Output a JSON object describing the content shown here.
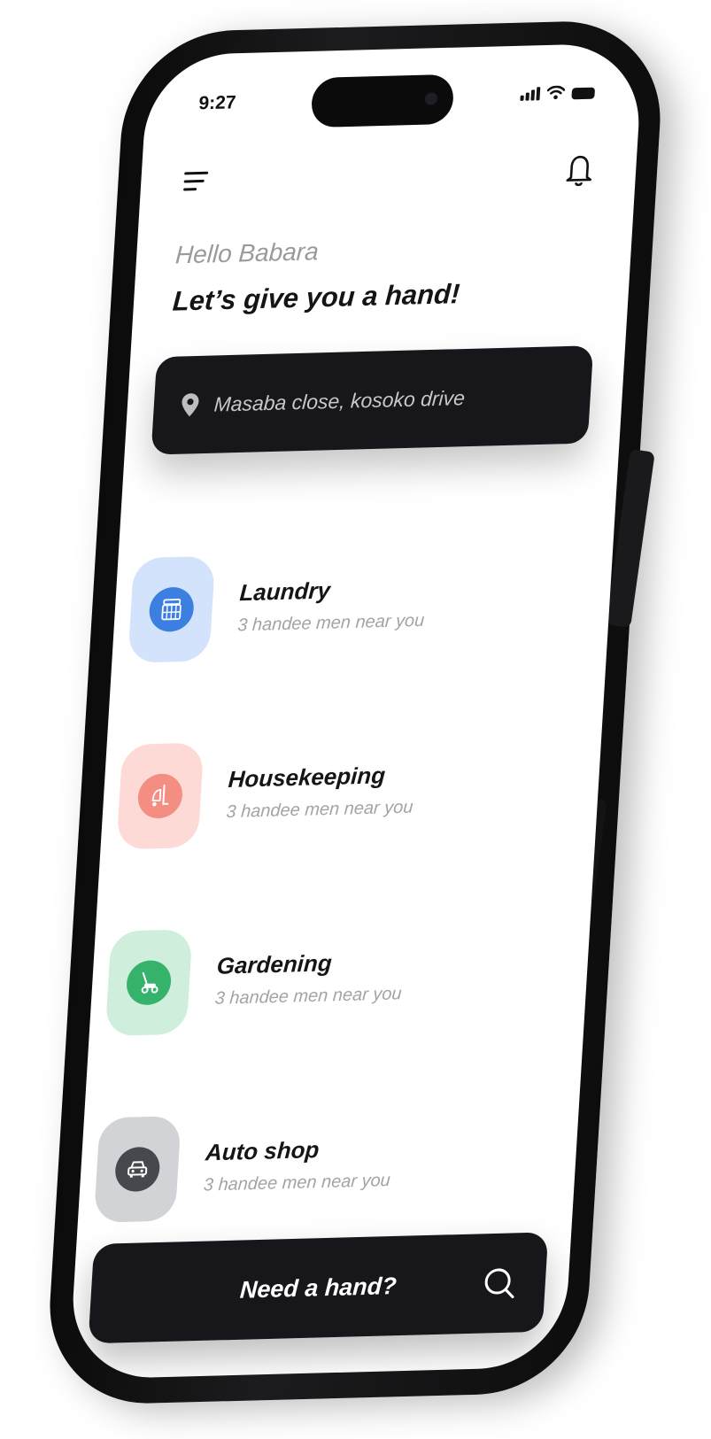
{
  "status_bar": {
    "time": "9:27"
  },
  "header": {
    "greeting": "Hello Babara",
    "headline": "Let’s give you a hand!"
  },
  "icons": {
    "menu": "menu-icon",
    "notifications": "bell-icon",
    "location": "location-pin-icon",
    "search": "search-icon"
  },
  "location": {
    "address": "Masaba close, kosoko drive"
  },
  "services": [
    {
      "name": "Laundry",
      "subtitle": "3 handee men near you",
      "icon": "laundry-basket-icon",
      "tile_color": "#D2E3FB",
      "circle_color": "#3C7FE0"
    },
    {
      "name": "Housekeeping",
      "subtitle": "3 handee men near you",
      "icon": "vacuum-cleaner-icon",
      "tile_color": "#FDDAD6",
      "circle_color": "#F48E82"
    },
    {
      "name": "Gardening",
      "subtitle": "3 handee men near you",
      "icon": "lawn-mower-icon",
      "tile_color": "#CFEEDB",
      "circle_color": "#35B36A"
    },
    {
      "name": "Auto shop",
      "subtitle": "3 handee men near you",
      "icon": "car-icon",
      "tile_color": "#D2D3D6",
      "circle_color": "#46484D"
    }
  ],
  "cta": {
    "label": "Need a hand?"
  },
  "colors": {
    "dark": "#17171B",
    "muted_text": "#A3A3A3"
  }
}
